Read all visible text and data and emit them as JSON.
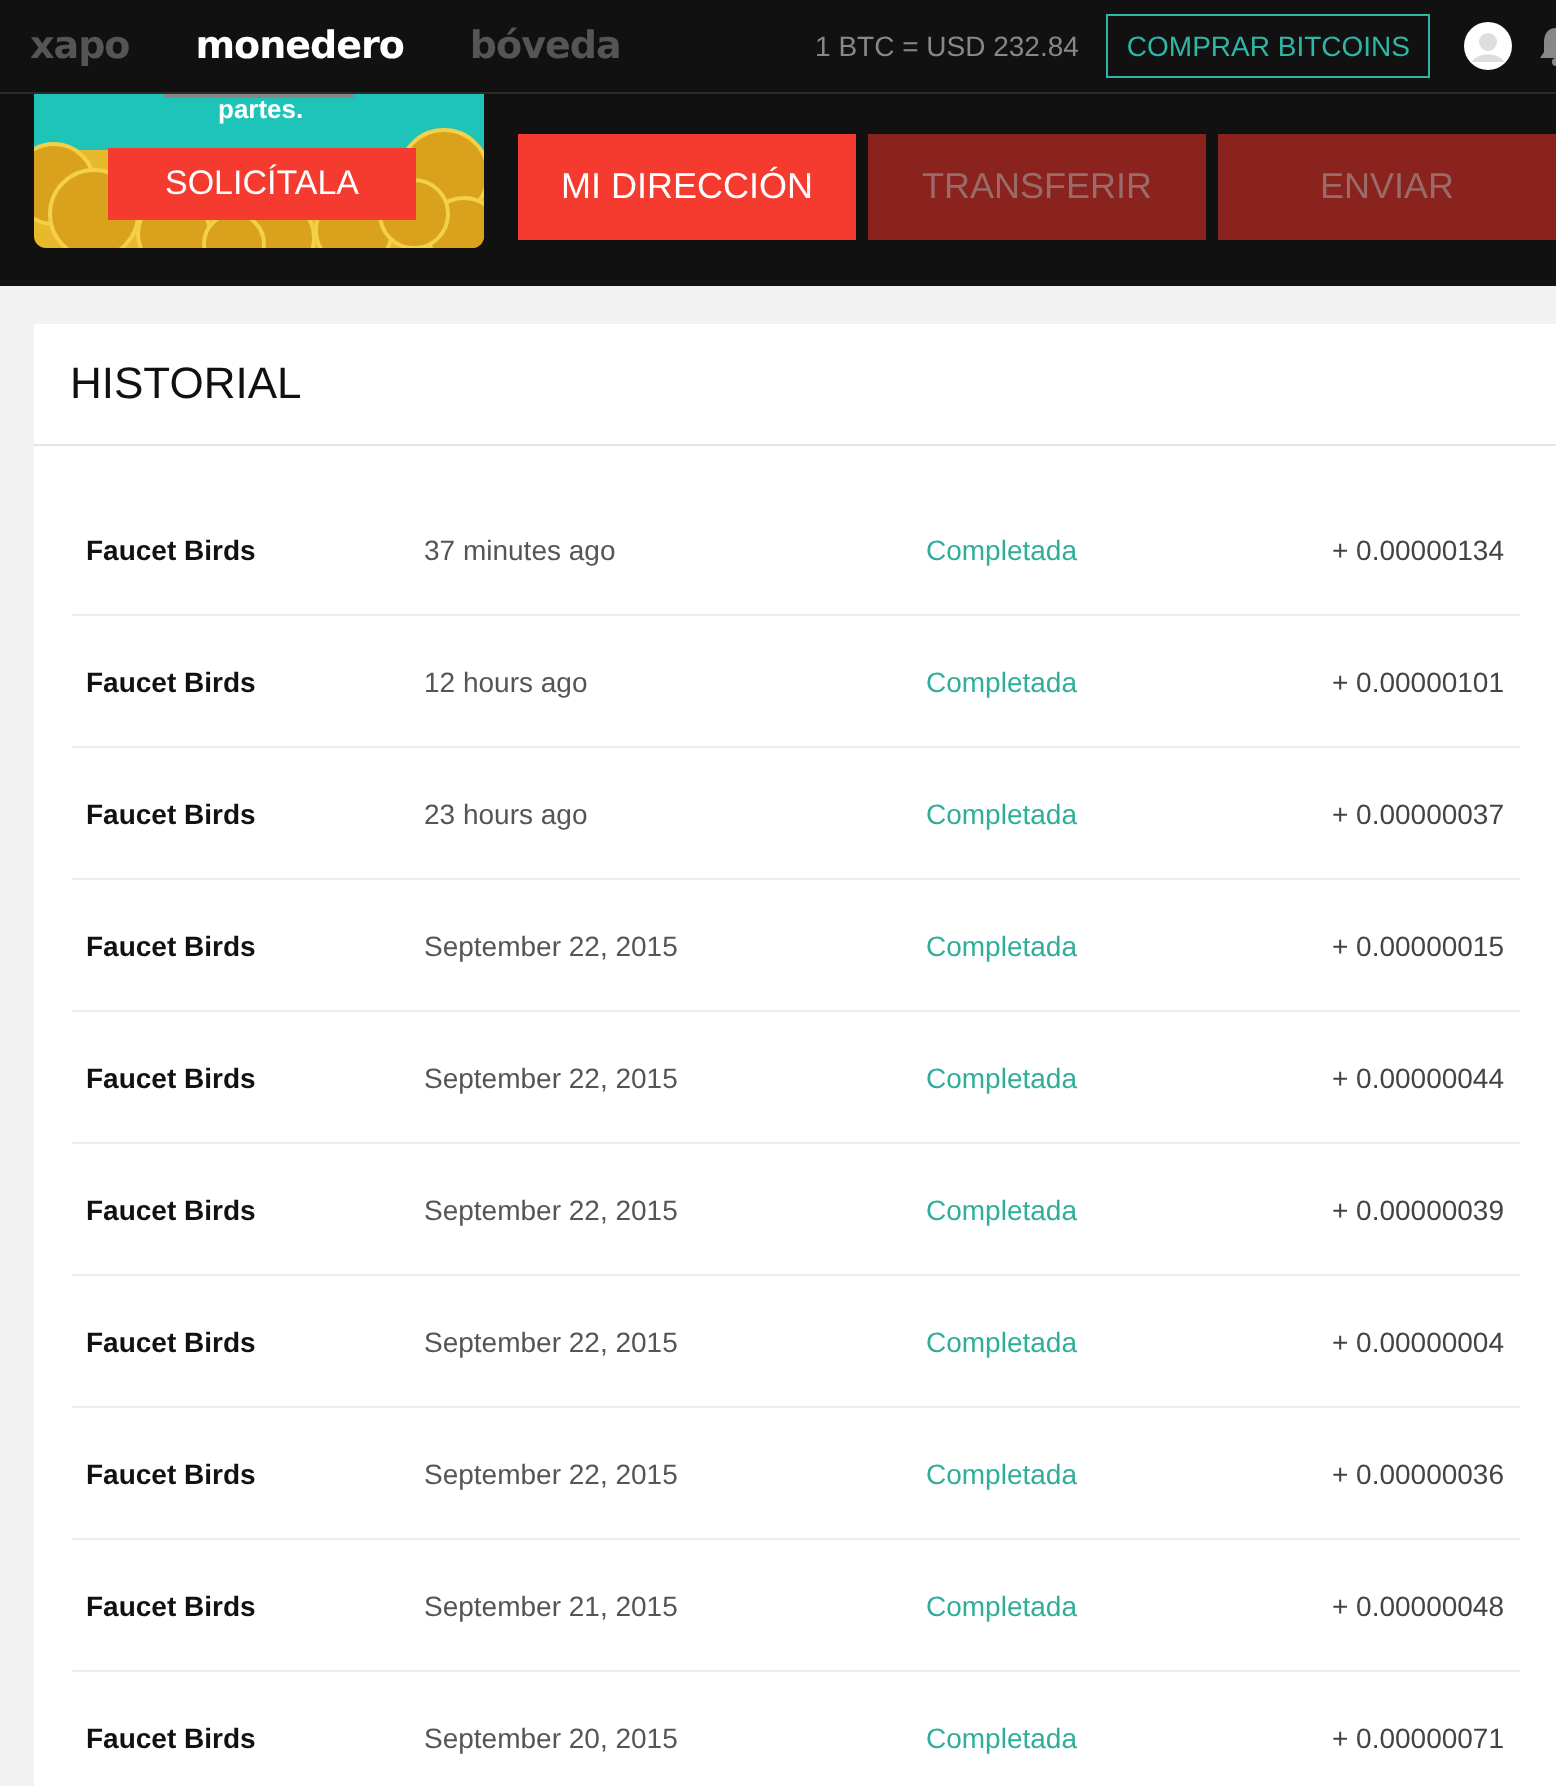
{
  "nav": {
    "tabs": [
      {
        "label": "xapo",
        "selected": false
      },
      {
        "label": "monedero",
        "selected": true
      },
      {
        "label": "bóveda",
        "selected": false
      }
    ],
    "rate": "1 BTC = USD 232.84",
    "buy_button": "COMPRAR BITCOINS"
  },
  "banner": {
    "kind": "picture",
    "text": "partes.",
    "button": "SOLICÍTALA"
  },
  "actions": [
    {
      "label": "MI DIRECCIÓN",
      "selected": true
    },
    {
      "label": "TRANSFERIR",
      "selected": false
    },
    {
      "label": "ENVIAR",
      "selected": false
    }
  ],
  "history": {
    "title": "HISTORIAL",
    "rows": [
      {
        "name": "Faucet Birds",
        "time": "37 minutes ago",
        "status": "Completada",
        "amount": "+ 0.00000134"
      },
      {
        "name": "Faucet Birds",
        "time": "12 hours ago",
        "status": "Completada",
        "amount": "+ 0.00000101"
      },
      {
        "name": "Faucet Birds",
        "time": "23 hours ago",
        "status": "Completada",
        "amount": "+ 0.00000037"
      },
      {
        "name": "Faucet Birds",
        "time": "September 22, 2015",
        "status": "Completada",
        "amount": "+ 0.00000015"
      },
      {
        "name": "Faucet Birds",
        "time": "September 22, 2015",
        "status": "Completada",
        "amount": "+ 0.00000044"
      },
      {
        "name": "Faucet Birds",
        "time": "September 22, 2015",
        "status": "Completada",
        "amount": "+ 0.00000039"
      },
      {
        "name": "Faucet Birds",
        "time": "September 22, 2015",
        "status": "Completada",
        "amount": "+ 0.00000004"
      },
      {
        "name": "Faucet Birds",
        "time": "September 22, 2015",
        "status": "Completada",
        "amount": "+ 0.00000036"
      },
      {
        "name": "Faucet Birds",
        "time": "September 21, 2015",
        "status": "Completada",
        "amount": "+ 0.00000048"
      },
      {
        "name": "Faucet Birds",
        "time": "September 20, 2015",
        "status": "Completada",
        "amount": "+ 0.00000071"
      }
    ]
  }
}
